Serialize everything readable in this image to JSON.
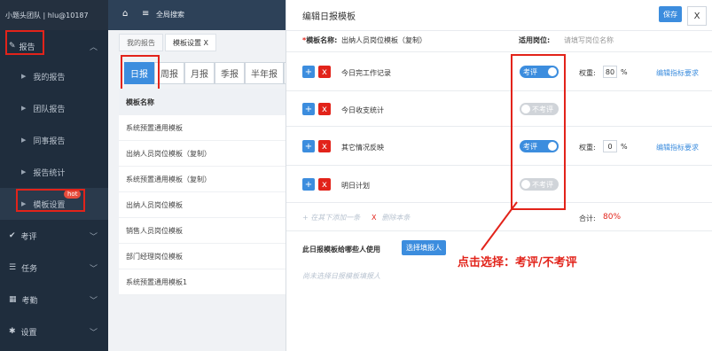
{
  "sidebar": {
    "account": "小题头团队 | hlu@10187",
    "items": [
      {
        "label": "报告",
        "icon": "edit-icon"
      },
      {
        "label": "我的报告"
      },
      {
        "label": "团队报告"
      },
      {
        "label": "同事报告"
      },
      {
        "label": "报告统计"
      },
      {
        "label": "模板设置",
        "badge": "hot"
      },
      {
        "label": "考评",
        "icon": "check-icon"
      },
      {
        "label": "任务",
        "icon": "list-icon"
      },
      {
        "label": "考勤",
        "icon": "calendar-icon"
      },
      {
        "label": "设置",
        "icon": "gear-icon"
      }
    ]
  },
  "topbar": {
    "search": "全局搜索"
  },
  "tabs": [
    {
      "label": "我的报告"
    },
    {
      "label": "模板设置 X"
    }
  ],
  "periods": [
    "日报",
    "周报",
    "月报",
    "季报",
    "半年报",
    "年"
  ],
  "table": {
    "header": "模板名称",
    "rows": [
      "系统预置通用模板",
      "出纳人员岗位模板（复制）",
      "系统预置通用模板（复制）",
      "出纳人员岗位模板",
      "销售人员岗位模板",
      "部门经理岗位模板",
      "系统预置通用模板1"
    ]
  },
  "panel": {
    "title": "编辑日报模板",
    "save": "保存",
    "close": "X",
    "name_label": "模板名称:",
    "name_value": "出纳人员岗位模板（复制）",
    "post_label": "适用岗位:",
    "post_placeholder": "请填写岗位名称",
    "items": [
      {
        "name": "今日完工作记录",
        "toggle": "考评",
        "on": true,
        "weight": "80"
      },
      {
        "name": "今日收支统计",
        "toggle": "不考评",
        "on": false
      },
      {
        "name": "其它情况反映",
        "toggle": "考评",
        "on": true,
        "weight": "0"
      },
      {
        "name": "明日计划",
        "toggle": "不考评",
        "on": false
      }
    ],
    "weight_label": "权重:",
    "percent": "%",
    "edit_link": "编辑指标要求",
    "add_below": "在其下添加一条",
    "delete_item": "删除本条",
    "total_label": "合计:",
    "total_value": "80%",
    "users_label": "此日报模板给哪些人使用",
    "choose_btn": "选择填报人",
    "no_users": "尚未选择日报模板填报人",
    "annotation": "点击选择：考评/不考评"
  },
  "colors": {
    "accent": "#3c8dde",
    "danger": "#e2231a",
    "sidebar": "#1f2d3d"
  }
}
